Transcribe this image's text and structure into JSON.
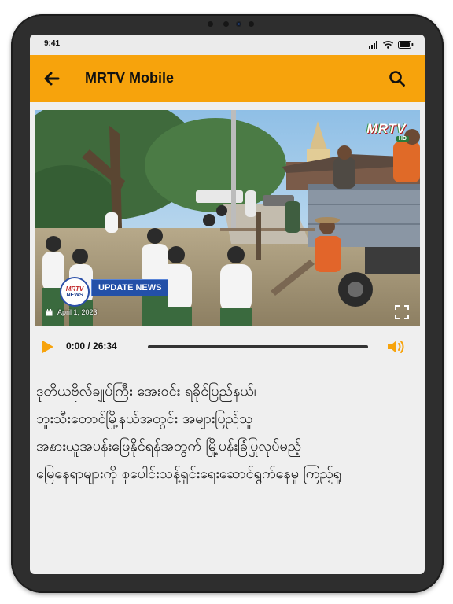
{
  "status_bar": {
    "time": "9:41",
    "icons": [
      "cellular-signal-icon",
      "wifi-icon",
      "battery-icon"
    ]
  },
  "app_bar": {
    "title": "MRTV Mobile",
    "back_icon": "arrow-left-icon",
    "search_icon": "search-icon",
    "background_color": "#f7a30c"
  },
  "video": {
    "channel_logo": "MRTV",
    "channel_logo_sub": "HD",
    "news_badge_line1": "MRTV",
    "news_badge_line2": "NEWS",
    "badge_label": "UPDATE NEWS",
    "date": "April 1, 2023",
    "fullscreen_icon": "fullscreen-icon"
  },
  "player": {
    "current_time": "0:00",
    "duration": "26:34",
    "time_display": "0:00 / 26:34",
    "progress": 0,
    "accent_color": "#f7a30c"
  },
  "article": {
    "lines": [
      "ဒုတိယဗိုလ်ချုပ်ကြီး အေးဝင်း ရခိုင်ပြည်နယ်၊",
      "ဘူးသီးတောင်မြို့နယ်အတွင်း အများပြည်သူ",
      "အနားယူအပန်းဖြေနိုင်ရန်အတွက် မြို့ပန်းခြံပြုလုပ်မည့်",
      "မြေနေရာများကို စုပေါင်းသန့်ရှင်းရေးဆောင်ရွက်နေမှု ကြည့်ရှု"
    ]
  }
}
